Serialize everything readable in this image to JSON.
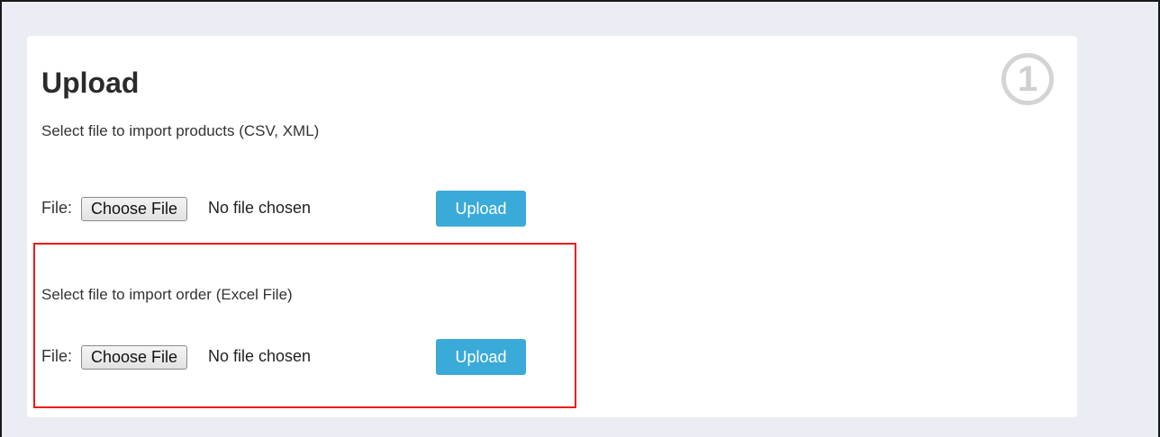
{
  "panel": {
    "step_number": "1",
    "title": "Upload"
  },
  "products_import": {
    "description": "Select file to import products (CSV, XML)",
    "file_label": "File:",
    "choose_file_label": "Choose File",
    "no_file_text": "No file chosen",
    "upload_label": "Upload"
  },
  "order_import": {
    "description": "Select file to import order (Excel File)",
    "file_label": "File:",
    "choose_file_label": "Choose File",
    "no_file_text": "No file chosen",
    "upload_label": "Upload"
  },
  "colors": {
    "page_background": "#eaeef4",
    "panel_background": "#ffffff",
    "upload_button": "#3aaad8",
    "highlight_border": "#f01818",
    "step_badge": "#d4d4d4"
  }
}
